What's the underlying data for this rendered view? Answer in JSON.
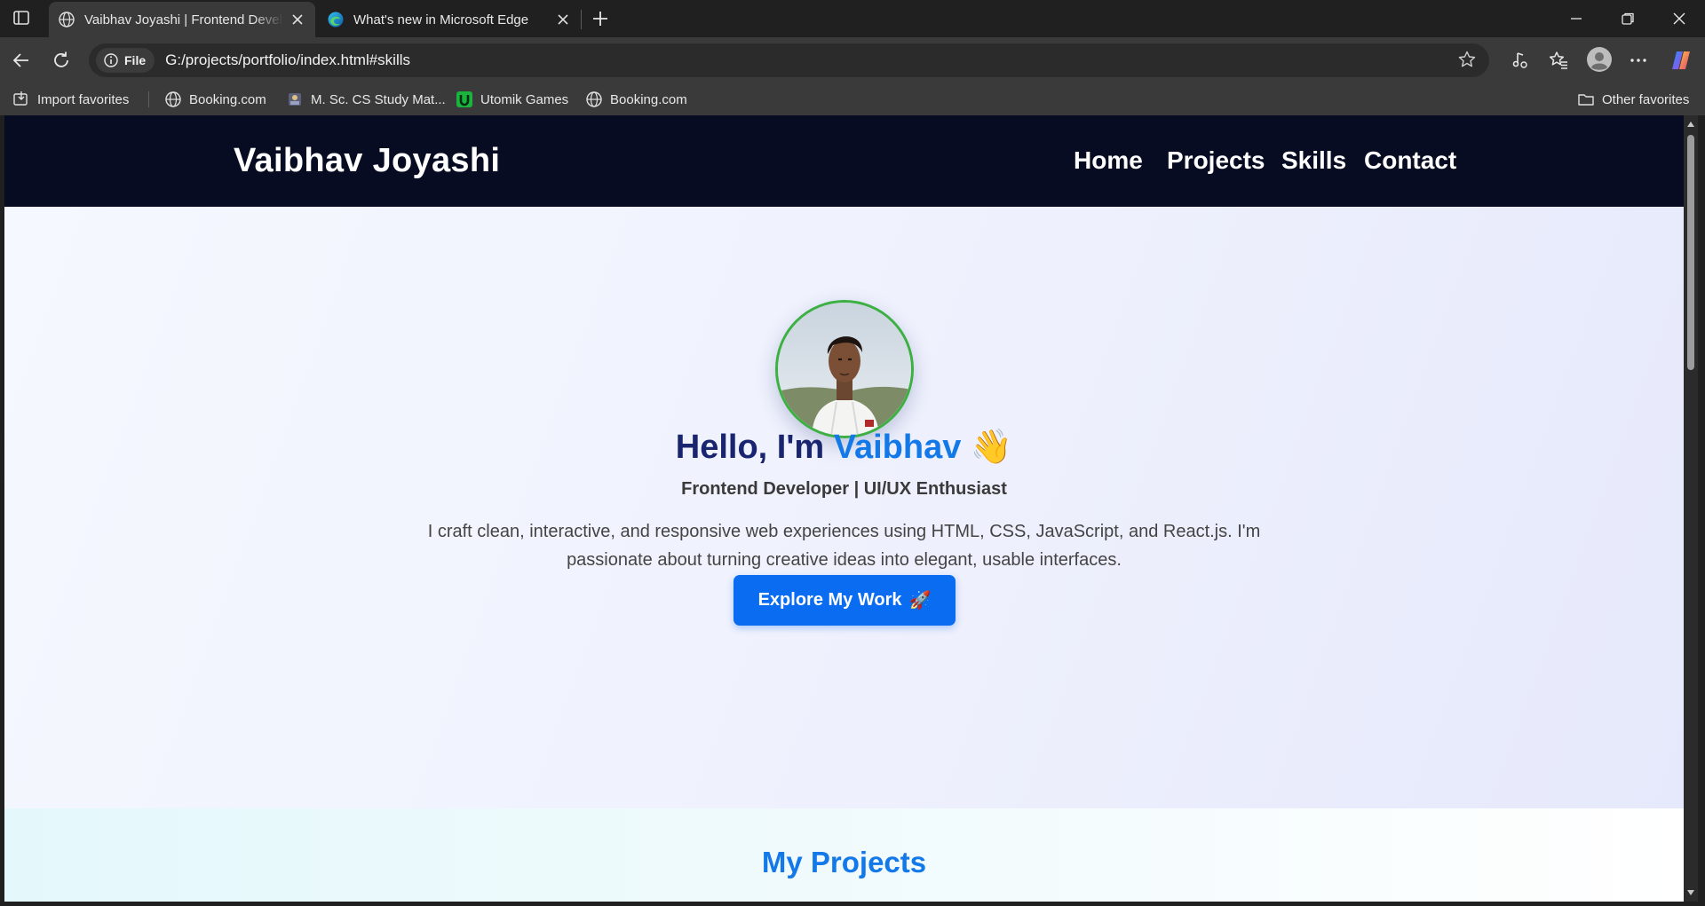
{
  "browser": {
    "tabs": [
      {
        "title": "Vaibhav Joyashi | Frontend Developer",
        "active": true
      },
      {
        "title": "What's new in Microsoft Edge",
        "active": false
      }
    ],
    "address": {
      "scheme_label": "File",
      "url": "G:/projects/portfolio/index.html#skills"
    },
    "favorites": [
      {
        "label": "Import favorites",
        "icon": "import-favorites-icon"
      },
      {
        "label": "Booking.com",
        "icon": "globe-icon"
      },
      {
        "label": "M. Sc. CS Study Mat...",
        "icon": "study-material-icon"
      },
      {
        "label": "Utomik Games",
        "icon": "utomik-icon"
      },
      {
        "label": "Booking.com",
        "icon": "globe-icon"
      }
    ],
    "other_favorites": "Other favorites"
  },
  "site": {
    "brand": "Vaibhav Joyashi",
    "nav": [
      "Home",
      "Projects",
      "Skills",
      "Contact"
    ],
    "hero": {
      "greeting": "Hello, I'm",
      "name": "Vaibhav",
      "wave": "👋",
      "subtitle": "Frontend Developer | UI/UX Enthusiast",
      "description": "I craft clean, interactive, and responsive web experiences using HTML, CSS, JavaScript, and React.js. I'm passionate about turning creative ideas into elegant, usable interfaces.",
      "cta_label": "Explore My Work",
      "cta_emoji": "🚀"
    },
    "projects_title": "My Projects"
  },
  "colors": {
    "header_bg": "#070c22",
    "accent_blue": "#1479e8",
    "button_blue": "#0a6cf0",
    "avatar_ring": "#3cb043",
    "title_navy": "#1a2570"
  }
}
